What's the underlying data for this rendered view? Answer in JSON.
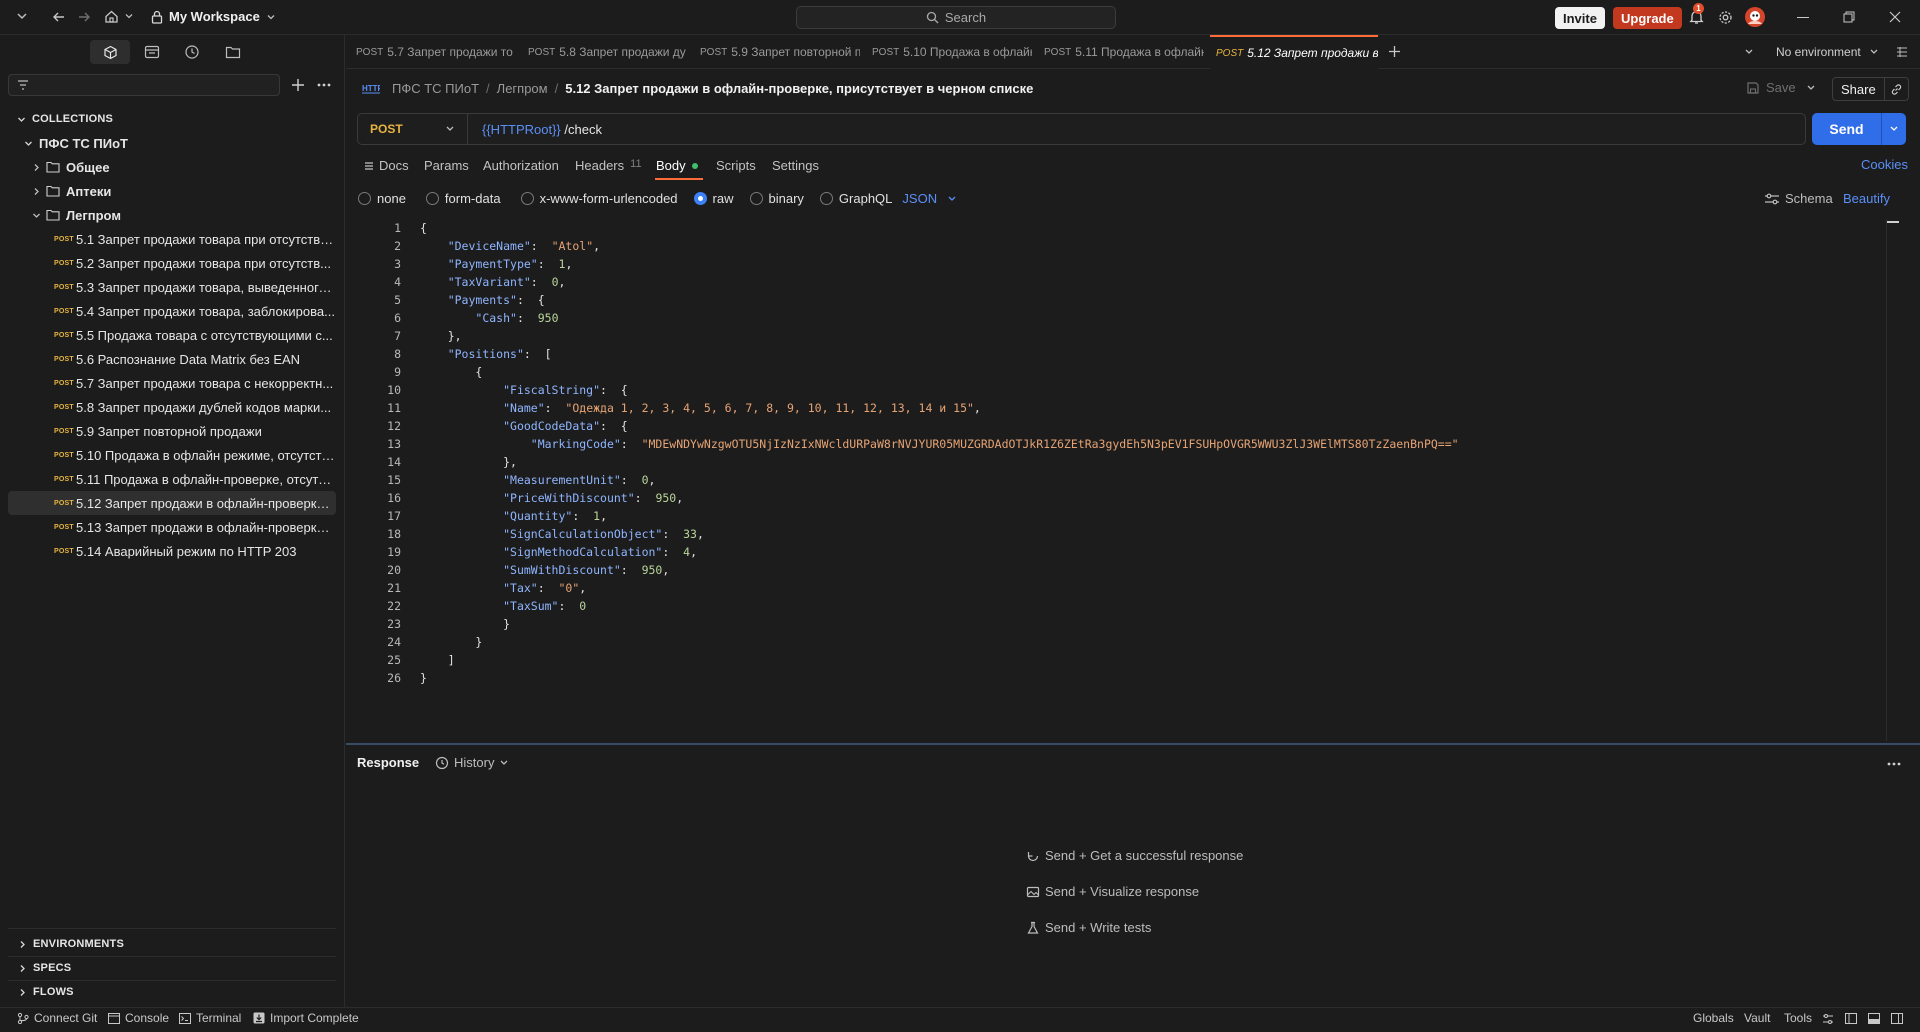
{
  "topbar": {
    "workspace": "My Workspace",
    "search_placeholder": "Search",
    "invite": "Invite",
    "upgrade": "Upgrade",
    "notification_count": "1"
  },
  "sidebar": {
    "filter_placeholder": "",
    "collections_header": "COLLECTIONS",
    "collection_name": "ПФС ТС ПИоТ",
    "folders": [
      "Общее",
      "Аптеки",
      "Легпром"
    ],
    "requests": [
      {
        "method": "POST",
        "name": "5.1 Запрет продажи товара при отсутстви..."
      },
      {
        "method": "POST",
        "name": "5.2 Запрет продажи товара при отсутств..."
      },
      {
        "method": "POST",
        "name": "5.3 Запрет продажи товара, выведенного..."
      },
      {
        "method": "POST",
        "name": "5.4 Запрет продажи товара, заблокирова..."
      },
      {
        "method": "POST",
        "name": "5.5 Продажа товара с отсутствующими с..."
      },
      {
        "method": "POST",
        "name": "5.6 Распознание Data Matrix без EAN"
      },
      {
        "method": "POST",
        "name": "5.7 Запрет продажи товара с некорректн..."
      },
      {
        "method": "POST",
        "name": "5.8 Запрет продажи дублей кодов марки..."
      },
      {
        "method": "POST",
        "name": "5.9 Запрет повторной продажи"
      },
      {
        "method": "POST",
        "name": "5.10 Продажа в офлайн режиме, отсутств..."
      },
      {
        "method": "POST",
        "name": "5.11 Продажа в офлайн-проверке, отсутст..."
      },
      {
        "method": "POST",
        "name": "5.12 Запрет продажи в офлайн-проверке,..."
      },
      {
        "method": "POST",
        "name": "5.13 Запрет продажи в офлайн-проверке ..."
      },
      {
        "method": "POST",
        "name": "5.14 Аварийный режим по HTTP 203"
      }
    ],
    "bottom_sections": [
      "ENVIRONMENTS",
      "SPECS",
      "FLOWS"
    ]
  },
  "tabs": [
    {
      "method": "POST",
      "label": "5.7 Запрет продажи то"
    },
    {
      "method": "POST",
      "label": "5.8 Запрет продажи ду"
    },
    {
      "method": "POST",
      "label": "5.9 Запрет повторной п"
    },
    {
      "method": "POST",
      "label": "5.10 Продажа в офлайн"
    },
    {
      "method": "POST",
      "label": "5.11 Продажа в офлайн"
    },
    {
      "method": "POST",
      "label": "5.12 Запрет продажи в"
    }
  ],
  "environment": "No environment",
  "breadcrumb": {
    "collection": "ПФС ТС ПИоТ",
    "folder": "Легпром",
    "request": "5.12 Запрет продажи в офлайн-проверке, присутствует в черном списке"
  },
  "header_actions": {
    "save": "Save",
    "share": "Share"
  },
  "request": {
    "method": "POST",
    "url_var": "{{HTTPRoot}}",
    "url_path": " /check",
    "send": "Send"
  },
  "request_tabs": {
    "docs": "Docs",
    "params": "Params",
    "authorization": "Authorization",
    "headers": "Headers",
    "headers_count": "11",
    "body": "Body",
    "scripts": "Scripts",
    "settings": "Settings",
    "cookies": "Cookies"
  },
  "body_options": {
    "none": "none",
    "form_data": "form-data",
    "urlencoded": "x-www-form-urlencoded",
    "raw": "raw",
    "binary": "binary",
    "graphql": "GraphQL",
    "format": "JSON",
    "schema": "Schema",
    "beautify": "Beautify"
  },
  "code_lines": [
    [
      [
        "p",
        "{"
      ]
    ],
    [
      [
        "p",
        "    "
      ],
      [
        "k",
        "\"DeviceName\""
      ],
      [
        "p",
        ":  "
      ],
      [
        "s",
        "\"Atol\""
      ],
      [
        "p",
        ","
      ]
    ],
    [
      [
        "p",
        "    "
      ],
      [
        "k",
        "\"PaymentType\""
      ],
      [
        "p",
        ":  "
      ],
      [
        "n",
        "1"
      ],
      [
        "p",
        ","
      ]
    ],
    [
      [
        "p",
        "    "
      ],
      [
        "k",
        "\"TaxVariant\""
      ],
      [
        "p",
        ":  "
      ],
      [
        "n",
        "0"
      ],
      [
        "p",
        ","
      ]
    ],
    [
      [
        "p",
        "    "
      ],
      [
        "k",
        "\"Payments\""
      ],
      [
        "p",
        ":  {"
      ]
    ],
    [
      [
        "p",
        "        "
      ],
      [
        "k",
        "\"Cash\""
      ],
      [
        "p",
        ":  "
      ],
      [
        "n",
        "950"
      ]
    ],
    [
      [
        "p",
        "    },"
      ]
    ],
    [
      [
        "p",
        "    "
      ],
      [
        "k",
        "\"Positions\""
      ],
      [
        "p",
        ":  ["
      ]
    ],
    [
      [
        "p",
        "        {"
      ]
    ],
    [
      [
        "p",
        "            "
      ],
      [
        "k",
        "\"FiscalString\""
      ],
      [
        "p",
        ":  {"
      ]
    ],
    [
      [
        "p",
        "            "
      ],
      [
        "k",
        "\"Name\""
      ],
      [
        "p",
        ":  "
      ],
      [
        "s",
        "\"Одежда 1, 2, 3, 4, 5, 6, 7, 8, 9, 10, 11, 12, 13, 14 и 15\""
      ],
      [
        "p",
        ","
      ]
    ],
    [
      [
        "p",
        "            "
      ],
      [
        "k",
        "\"GoodCodeData\""
      ],
      [
        "p",
        ":  {"
      ]
    ],
    [
      [
        "p",
        "                "
      ],
      [
        "k",
        "\"MarkingCode\""
      ],
      [
        "p",
        ":  "
      ],
      [
        "s",
        "\"MDEwNDYwNzgwOTU5NjIzNzIxNWcldURPaW8rNVJYUR05MUZGRDAdOTJkR1Z6ZEtRa3gydEh5N3pEV1FSUHpOVGR5WWU3ZlJ3WElMTS80TzZaenBnPQ==\""
      ]
    ],
    [
      [
        "p",
        "            },"
      ]
    ],
    [
      [
        "p",
        "            "
      ],
      [
        "k",
        "\"MeasurementUnit\""
      ],
      [
        "p",
        ":  "
      ],
      [
        "n",
        "0"
      ],
      [
        "p",
        ","
      ]
    ],
    [
      [
        "p",
        "            "
      ],
      [
        "k",
        "\"PriceWithDiscount\""
      ],
      [
        "p",
        ":  "
      ],
      [
        "n",
        "950"
      ],
      [
        "p",
        ","
      ]
    ],
    [
      [
        "p",
        "            "
      ],
      [
        "k",
        "\"Quantity\""
      ],
      [
        "p",
        ":  "
      ],
      [
        "n",
        "1"
      ],
      [
        "p",
        ","
      ]
    ],
    [
      [
        "p",
        "            "
      ],
      [
        "k",
        "\"SignCalculationObject\""
      ],
      [
        "p",
        ":  "
      ],
      [
        "n",
        "33"
      ],
      [
        "p",
        ","
      ]
    ],
    [
      [
        "p",
        "            "
      ],
      [
        "k",
        "\"SignMethodCalculation\""
      ],
      [
        "p",
        ":  "
      ],
      [
        "n",
        "4"
      ],
      [
        "p",
        ","
      ]
    ],
    [
      [
        "p",
        "            "
      ],
      [
        "k",
        "\"SumWithDiscount\""
      ],
      [
        "p",
        ":  "
      ],
      [
        "n",
        "950"
      ],
      [
        "p",
        ","
      ]
    ],
    [
      [
        "p",
        "            "
      ],
      [
        "k",
        "\"Tax\""
      ],
      [
        "p",
        ":  "
      ],
      [
        "s",
        "\"0\""
      ],
      [
        "p",
        ","
      ]
    ],
    [
      [
        "p",
        "            "
      ],
      [
        "k",
        "\"TaxSum\""
      ],
      [
        "p",
        ":  "
      ],
      [
        "n",
        "0"
      ]
    ],
    [
      [
        "p",
        "            }"
      ]
    ],
    [
      [
        "p",
        "        }"
      ]
    ],
    [
      [
        "p",
        "    ]"
      ]
    ],
    [
      [
        "p",
        "}"
      ]
    ]
  ],
  "response": {
    "title": "Response",
    "history": "History",
    "hints": [
      "Send + Get a successful response",
      "Send + Visualize response",
      "Send + Write tests"
    ]
  },
  "statusbar": {
    "connect_git": "Connect Git",
    "console": "Console",
    "terminal": "Terminal",
    "import_complete": "Import Complete",
    "globals": "Globals",
    "vault": "Vault",
    "tools": "Tools"
  }
}
